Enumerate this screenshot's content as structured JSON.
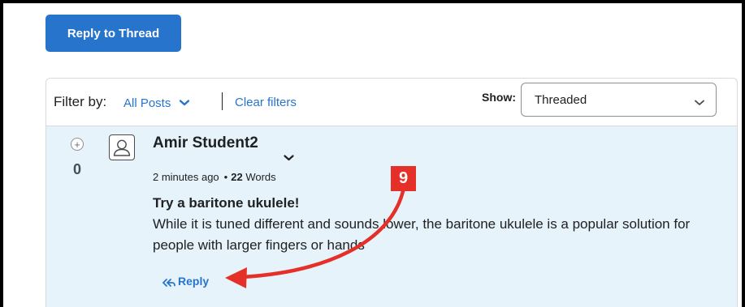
{
  "toolbar": {
    "reply_thread_label": "Reply to Thread"
  },
  "filter": {
    "label": "Filter by:",
    "all_posts_label": "All Posts",
    "clear_filters_label": "Clear filters",
    "show_label": "Show:",
    "show_value": "Threaded"
  },
  "post": {
    "vote_count": "0",
    "author": "Amir Student2",
    "time_ago": "2 minutes ago",
    "word_count": "22",
    "word_label": "Words",
    "title": "Try a baritone ukulele!",
    "body": "While it is tuned different and sounds lower, the baritone ukulele is a popular solution for people with larger fingers or hands",
    "reply_label": "Reply"
  },
  "annotation": {
    "step_number": "9",
    "color": "#e53029"
  },
  "colors": {
    "primary": "#2774cc",
    "post_background": "#e6f3fb"
  },
  "icons": [
    "chevron-down-icon",
    "plus-icon",
    "user-avatar-icon",
    "reply-icon",
    "arrow-annotation"
  ]
}
